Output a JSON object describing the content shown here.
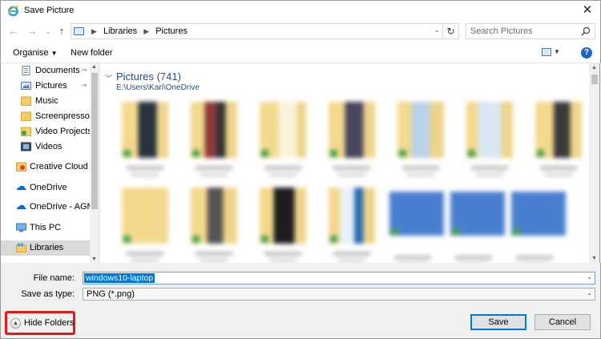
{
  "window": {
    "title": "Save Picture",
    "close_glyph": "✕"
  },
  "nav": {
    "back_glyph": "←",
    "forward_glyph": "→",
    "recent_glyph": "⌄",
    "up_glyph": "↑",
    "breadcrumbs": [
      "Libraries",
      "Pictures"
    ],
    "refresh_glyph": "↻",
    "search_placeholder": "Search Pictures"
  },
  "toolbar": {
    "organise_label": "Organise",
    "new_folder_label": "New folder",
    "help_glyph": "?"
  },
  "sidebar": {
    "items": [
      {
        "label": "Documents",
        "icon": "documents-icon",
        "pinned": true
      },
      {
        "label": "Pictures",
        "icon": "pictures-icon",
        "pinned": true
      },
      {
        "label": "Music",
        "icon": "folder-icon",
        "pinned": false
      },
      {
        "label": "Screenpresso",
        "icon": "folder-icon",
        "pinned": false
      },
      {
        "label": "Video Projects",
        "icon": "video-projects-icon",
        "pinned": false
      },
      {
        "label": "Videos",
        "icon": "videos-icon",
        "pinned": false
      },
      {
        "label": "Creative Cloud Fil",
        "icon": "creative-cloud-icon",
        "pinned": false
      },
      {
        "label": "OneDrive",
        "icon": "onedrive-icon",
        "pinned": false
      },
      {
        "label": "OneDrive - AGM N",
        "icon": "onedrive-icon",
        "pinned": false
      },
      {
        "label": "This PC",
        "icon": "this-pc-icon",
        "pinned": false
      },
      {
        "label": "Libraries",
        "icon": "libraries-icon",
        "pinned": false,
        "selected": true
      }
    ],
    "pin_glyph": "📌"
  },
  "content": {
    "group_title": "Pictures (741)",
    "group_path": "E:\\Users\\Kari\\OneDrive",
    "thumbnails_note": "blurred"
  },
  "form": {
    "filename_label": "File name:",
    "filename_value": "windows10-laptop",
    "savetype_label": "Save as type:",
    "savetype_value": "PNG (*.png)"
  },
  "footer": {
    "hide_folders_label": "Hide Folders",
    "save_label": "Save",
    "cancel_label": "Cancel"
  },
  "colors": {
    "accent": "#0078d7",
    "highlight_border": "#e01919",
    "group_text": "#1e4e8c"
  }
}
